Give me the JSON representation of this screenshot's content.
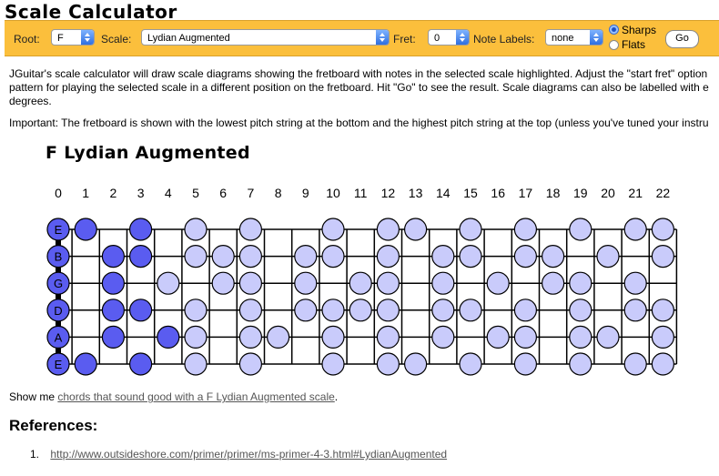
{
  "app": {
    "title": "Scale Calculator"
  },
  "toolbar": {
    "root_label": "Root:",
    "root_value": "F",
    "scale_label": "Scale:",
    "scale_value": "Lydian Augmented",
    "fret_label": "Fret:",
    "fret_value": "0",
    "labels_label": "Note Labels:",
    "labels_value": "none",
    "sharps_label": "Sharps",
    "flats_label": "Flats",
    "selected_accidental": "sharps",
    "go_label": "Go"
  },
  "intro": {
    "line1": "JGuitar's scale calculator will draw scale diagrams showing the fretboard with notes in the selected scale highlighted. Adjust the \"start fret\" option",
    "line2": "pattern for playing the selected scale in a different position on the fretboard. Hit \"Go\" to see the result. Scale diagrams can also be labelled with e",
    "line3": "degrees.",
    "important": "Important: The fretboard is shown with the lowest pitch string at the bottom and the highest pitch string at the top (unless you've tuned your instru"
  },
  "diagram": {
    "title": "F Lydian Augmented",
    "fret_numbers": [
      "0",
      "1",
      "2",
      "3",
      "4",
      "5",
      "6",
      "7",
      "8",
      "9",
      "10",
      "11",
      "12",
      "13",
      "14",
      "15",
      "16",
      "17",
      "18",
      "19",
      "20",
      "21",
      "22"
    ],
    "strings": [
      {
        "name": "E",
        "dark": [
          1,
          3
        ],
        "light": [
          5,
          7,
          10,
          12,
          13,
          15,
          17,
          19,
          21,
          22
        ]
      },
      {
        "name": "B",
        "dark": [
          2,
          3
        ],
        "light": [
          5,
          6,
          7,
          9,
          10,
          12,
          14,
          15,
          17,
          18,
          20,
          22
        ]
      },
      {
        "name": "G",
        "dark": [
          2
        ],
        "light": [
          4,
          6,
          7,
          9,
          11,
          12,
          14,
          16,
          18,
          19,
          21
        ]
      },
      {
        "name": "D",
        "dark": [
          2,
          3
        ],
        "light": [
          5,
          7,
          9,
          10,
          11,
          12,
          14,
          15,
          17,
          19,
          21,
          22
        ]
      },
      {
        "name": "A",
        "dark": [
          2,
          4
        ],
        "light": [
          5,
          7,
          8,
          10,
          12,
          14,
          16,
          17,
          19,
          20,
          22
        ]
      },
      {
        "name": "E",
        "dark": [
          1,
          3
        ],
        "light": [
          5,
          7,
          10,
          12,
          13,
          15,
          17,
          19,
          21,
          22
        ]
      }
    ],
    "colors": {
      "root": "#5a5cf0",
      "dark": "#5a5cf0",
      "light": "#c9cbfb",
      "stroke": "#000"
    }
  },
  "footer": {
    "prefix": "Show me ",
    "link": "chords that sound good with a F Lydian Augmented scale",
    "suffix": "."
  },
  "references": {
    "heading": "References:",
    "items": [
      {
        "number": "1.",
        "url": "http://www.outsideshore.com/primer/primer/ms-primer-4-3.html#LydianAugmented"
      }
    ]
  }
}
